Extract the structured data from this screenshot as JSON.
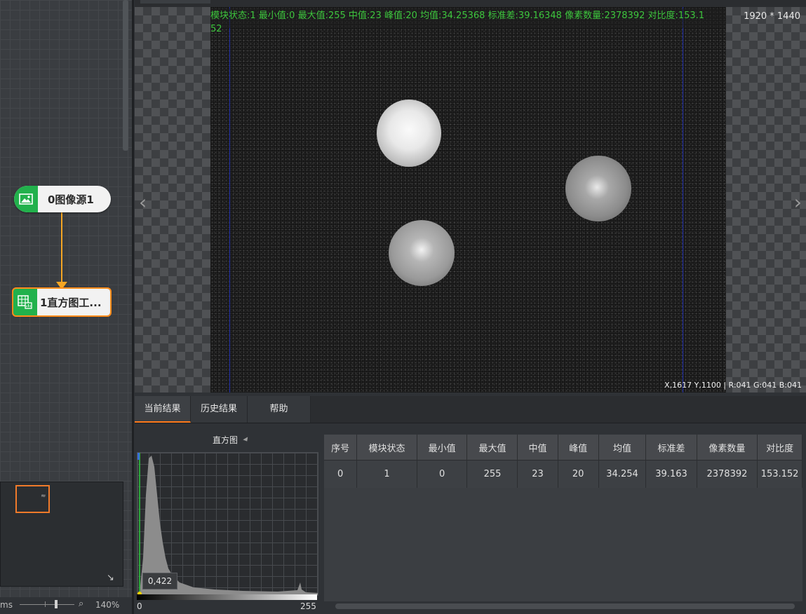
{
  "flow": {
    "nodes": [
      {
        "label": "0图像源1",
        "icon": "image-icon"
      },
      {
        "label": "1直方图工...",
        "icon": "histogram-grid-icon"
      }
    ],
    "bottom_bar": {
      "left_text": "ms",
      "zoom": "140%",
      "zoom_level": 0.55
    }
  },
  "viewer": {
    "info_text": "模块状态:1 最小值:0 最大值:255 中值:23 峰值:20 均值:34.25368 标准差:39.16348 像素数量:2378392 对比度:153.152",
    "image_size": "1920 * 1440",
    "coord_text": "X,1617  Y,1100  |  R:041  G:041  B:041",
    "prev_arrow": "‹",
    "next_arrow": "›"
  },
  "tabs": [
    {
      "label": "当前结果",
      "active": true
    },
    {
      "label": "历史结果",
      "active": false
    },
    {
      "label": "帮助",
      "active": false
    }
  ],
  "histogram": {
    "title": "直方图",
    "axis_min": "0",
    "axis_max": "255",
    "tooltip": "0,422",
    "colors": {
      "fill": "#8c8c8c",
      "marker_line": "#2ecc40"
    }
  },
  "results_table": {
    "headers": [
      "序号",
      "模块状态",
      "最小值",
      "最大值",
      "中值",
      "峰值",
      "均值",
      "标准差",
      "像素数量",
      "对比度"
    ],
    "rows": [
      [
        "0",
        "1",
        "0",
        "255",
        "23",
        "20",
        "34.254",
        "39.163",
        "2378392",
        "153.152"
      ]
    ]
  }
}
